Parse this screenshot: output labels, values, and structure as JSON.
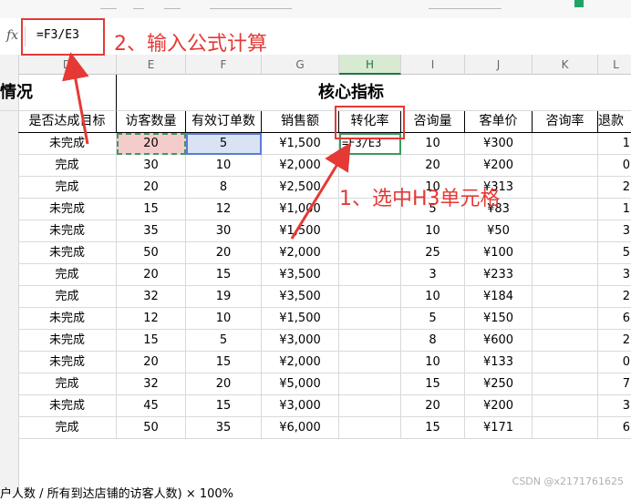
{
  "formula_bar": {
    "fx_label": "fx",
    "formula": "=F3/E3"
  },
  "columns": [
    {
      "label": "D"
    },
    {
      "label": "E"
    },
    {
      "label": "F"
    },
    {
      "label": "G"
    },
    {
      "label": "H"
    },
    {
      "label": "I"
    },
    {
      "label": "J"
    },
    {
      "label": "K"
    },
    {
      "label": "L"
    }
  ],
  "section_titles": {
    "left": "情况",
    "right": "核心指标"
  },
  "headers": [
    "是否达成目标",
    "访客数量",
    "有效订单数",
    "销售额",
    "转化率",
    "咨询量",
    "客单价",
    "咨询率",
    "退款"
  ],
  "rows": [
    [
      "未完成",
      "20",
      "5",
      "¥1,500",
      "=F3/E3",
      "10",
      "¥300",
      "",
      "1"
    ],
    [
      "完成",
      "30",
      "10",
      "¥2,000",
      "",
      "20",
      "¥200",
      "",
      "0"
    ],
    [
      "完成",
      "20",
      "8",
      "¥2,500",
      "",
      "10",
      "¥313",
      "",
      "2"
    ],
    [
      "未完成",
      "15",
      "12",
      "¥1,000",
      "",
      "5",
      "¥83",
      "",
      "1"
    ],
    [
      "未完成",
      "35",
      "30",
      "¥1,500",
      "",
      "10",
      "¥50",
      "",
      "3"
    ],
    [
      "未完成",
      "50",
      "20",
      "¥2,000",
      "",
      "25",
      "¥100",
      "",
      "5"
    ],
    [
      "完成",
      "20",
      "15",
      "¥3,500",
      "",
      "3",
      "¥233",
      "",
      "3"
    ],
    [
      "完成",
      "32",
      "19",
      "¥3,500",
      "",
      "10",
      "¥184",
      "",
      "2"
    ],
    [
      "未完成",
      "12",
      "10",
      "¥1,500",
      "",
      "5",
      "¥150",
      "",
      "6"
    ],
    [
      "未完成",
      "15",
      "5",
      "¥3,000",
      "",
      "8",
      "¥600",
      "",
      "2"
    ],
    [
      "未完成",
      "20",
      "15",
      "¥2,000",
      "",
      "10",
      "¥133",
      "",
      "0"
    ],
    [
      "完成",
      "32",
      "20",
      "¥5,000",
      "",
      "15",
      "¥250",
      "",
      "7"
    ],
    [
      "未完成",
      "45",
      "15",
      "¥3,000",
      "",
      "20",
      "¥200",
      "",
      "3"
    ],
    [
      "完成",
      "50",
      "35",
      "¥6,000",
      "",
      "15",
      "¥171",
      "",
      "6"
    ]
  ],
  "annotations": {
    "step1": "1、选中H3单元格",
    "step2": "2、输入公式计算"
  },
  "footer_note": "户人数 / 所有到达店铺的访客人数) × 100%",
  "watermark": "CSDN @x2171761625",
  "colors": {
    "accent": "#e53935",
    "selection": "#3c9a5f"
  }
}
